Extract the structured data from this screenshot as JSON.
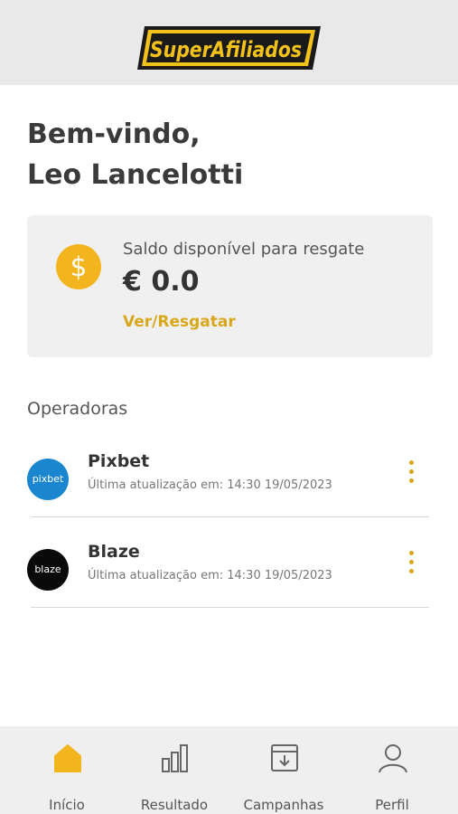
{
  "header": {
    "logo_text": "SuperAfiliados"
  },
  "welcome": {
    "line1": "Bem-vindo,",
    "line2": "Leo Lancelotti"
  },
  "balance": {
    "label": "Saldo disponível para resgate",
    "value": "€ 0.0",
    "link": "Ver/Resgatar",
    "icon": "dollar-coin-icon",
    "icon_glyph": "$"
  },
  "operators": {
    "title": "Operadoras",
    "items": [
      {
        "name": "Pixbet",
        "updated": "Última atualização em: 14:30 19/05/2023",
        "logo_text": "pixbet",
        "logo_color": "#1b86d0"
      },
      {
        "name": "Blaze",
        "updated": "Última atualização em: 14:30 19/05/2023",
        "logo_text": "blaze",
        "logo_color": "#0a0a0a"
      }
    ]
  },
  "tabbar": {
    "items": [
      {
        "label": "Início",
        "icon": "home-icon",
        "active": true
      },
      {
        "label": "Resultado",
        "icon": "bar-chart-icon",
        "active": false
      },
      {
        "label": "Campanhas",
        "icon": "download-box-icon",
        "active": false
      },
      {
        "label": "Perfil",
        "icon": "user-icon",
        "active": false
      }
    ]
  },
  "colors": {
    "accent": "#f3b51e",
    "link": "#d9a71a",
    "header_bg": "#e9e9e9",
    "card_bg": "#f0f0f0"
  }
}
